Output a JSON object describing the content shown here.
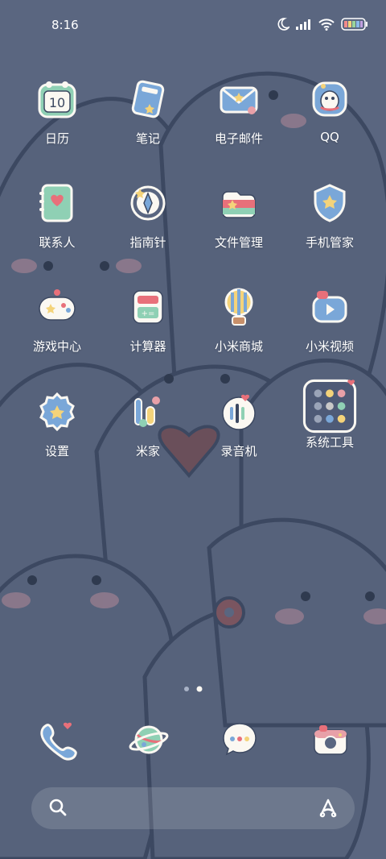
{
  "status_bar": {
    "time": "8:16",
    "icons": [
      "moon-icon",
      "signal-icon",
      "wifi-icon",
      "battery-icon"
    ]
  },
  "apps": [
    {
      "label": "日历",
      "icon": "calendar-icon",
      "badge": "10"
    },
    {
      "label": "笔记",
      "icon": "notes-icon"
    },
    {
      "label": "电子邮件",
      "icon": "email-icon"
    },
    {
      "label": "QQ",
      "icon": "qq-icon"
    },
    {
      "label": "联系人",
      "icon": "contacts-icon"
    },
    {
      "label": "指南针",
      "icon": "compass-icon"
    },
    {
      "label": "文件管理",
      "icon": "file-manager-icon"
    },
    {
      "label": "手机管家",
      "icon": "security-icon"
    },
    {
      "label": "游戏中心",
      "icon": "game-center-icon"
    },
    {
      "label": "计算器",
      "icon": "calculator-icon"
    },
    {
      "label": "小米商城",
      "icon": "mi-store-icon"
    },
    {
      "label": "小米视频",
      "icon": "mi-video-icon"
    },
    {
      "label": "设置",
      "icon": "settings-icon"
    },
    {
      "label": "米家",
      "icon": "mijia-icon"
    },
    {
      "label": "录音机",
      "icon": "recorder-icon"
    },
    {
      "label": "系统工具",
      "icon": "folder-icon"
    }
  ],
  "page_indicator": {
    "pages": 2,
    "current": 2
  },
  "dock": [
    {
      "name": "phone",
      "icon": "phone-icon"
    },
    {
      "name": "browser",
      "icon": "browser-planet-icon"
    },
    {
      "name": "messages",
      "icon": "messages-icon"
    },
    {
      "name": "camera",
      "icon": "camera-icon"
    }
  ],
  "search": {
    "placeholder": ""
  },
  "colors": {
    "wallpaper": "#5a6680",
    "shark_dark": "#3e4a60",
    "cheek": "#e8a0a8",
    "icon_white": "#fbf8f2",
    "accent_blue": "#7aa7d8",
    "accent_yellow": "#f4d37a"
  }
}
